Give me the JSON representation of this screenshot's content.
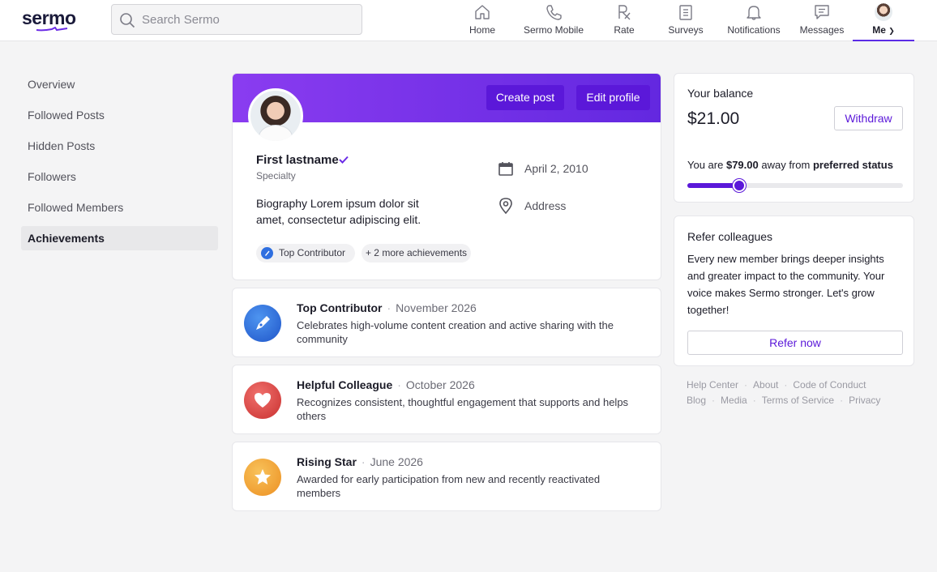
{
  "brand": {
    "logo_text": "sermo",
    "accent": "#5b18d9",
    "banner_from": "#8a3cf0",
    "banner_to": "#6328e0"
  },
  "search": {
    "placeholder": "Search Sermo"
  },
  "nav": {
    "items": [
      {
        "label": "Home",
        "icon": "home-icon"
      },
      {
        "label": "Sermo Mobile",
        "icon": "phone-icon"
      },
      {
        "label": "Rate",
        "icon": "rx-icon"
      },
      {
        "label": "Surveys",
        "icon": "clipboard-icon"
      },
      {
        "label": "Notifications",
        "icon": "bell-icon"
      },
      {
        "label": "Messages",
        "icon": "message-icon"
      }
    ],
    "me_label": "Me"
  },
  "sidebar": {
    "items": [
      {
        "label": "Overview"
      },
      {
        "label": "Followed Posts"
      },
      {
        "label": "Hidden Posts"
      },
      {
        "label": "Followers"
      },
      {
        "label": "Followed Members"
      },
      {
        "label": "Achievements",
        "active": true
      }
    ]
  },
  "profile": {
    "create_post_label": "Create post",
    "edit_profile_label": "Edit profile",
    "name": "First lastname",
    "specialty": "Specialty",
    "bio": "Biography Lorem ipsum dolor sit amet, consectetur adipiscing elit.",
    "date": "April 2, 2010",
    "address": "Address",
    "chip_primary": "Top Contributor",
    "chip_more": "+ 2 more achievements"
  },
  "achievements": [
    {
      "title": "Top Contributor",
      "date": "November 2026",
      "description": "Celebrates high-volume content creation and active sharing with the community",
      "icon": "pen-icon",
      "color": "#2f6fe0"
    },
    {
      "title": "Helpful Colleague",
      "date": "October 2026",
      "description": "Recognizes consistent, thoughtful engagement that supports and helps others",
      "icon": "heart-icon",
      "color": "#e2494a"
    },
    {
      "title": "Rising Star",
      "date": "June 2026",
      "description": "Awarded for early participation from new and recently reactivated members",
      "icon": "star-icon",
      "color": "#f2a636"
    }
  ],
  "balance": {
    "label": "Your balance",
    "amount": "$21.00",
    "withdraw_label": "Withdraw",
    "status_prefix": "You are",
    "status_amount": "$79.00",
    "status_middle": "away from",
    "status_target": "preferred status",
    "progress": 0.24
  },
  "refer": {
    "title": "Refer colleagues",
    "text": "Every new member brings deeper insights and greater impact to the community. Your voice makes Sermo stronger. Let's grow together!",
    "button_label": "Refer now"
  },
  "footer": {
    "row1": [
      "Help Center",
      "About",
      "Code of Conduct"
    ],
    "row2": [
      "Blog",
      "Media",
      "Terms of Service",
      "Privacy"
    ]
  }
}
